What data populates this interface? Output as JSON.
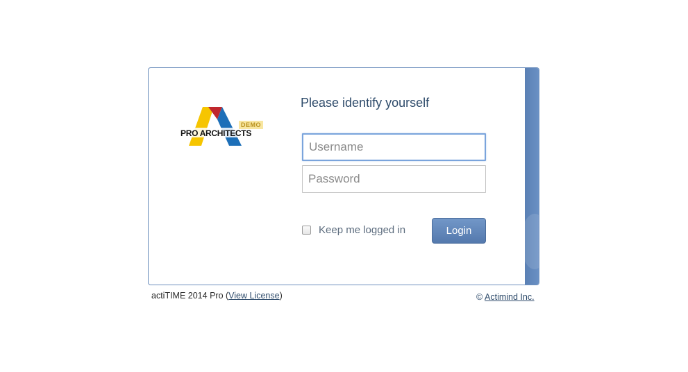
{
  "logo": {
    "name": "PRO ARCHITECTS",
    "badge": "DEMO",
    "colors": {
      "yellow": "#f6c500",
      "red": "#c0272d",
      "blue": "#1d6fb8"
    }
  },
  "form": {
    "title": "Please identify yourself",
    "username_placeholder": "Username",
    "username_value": "",
    "password_placeholder": "Password",
    "password_value": "",
    "remember_label": "Keep me logged in",
    "remember_checked": false,
    "login_label": "Login"
  },
  "footer": {
    "version": "actiTIME 2014 Pro",
    "license_link": "View License",
    "copyright_symbol": "©",
    "company_link": "Actimind Inc."
  },
  "colors": {
    "accent": "#5a80b4",
    "title_text": "#2d4a6a"
  }
}
